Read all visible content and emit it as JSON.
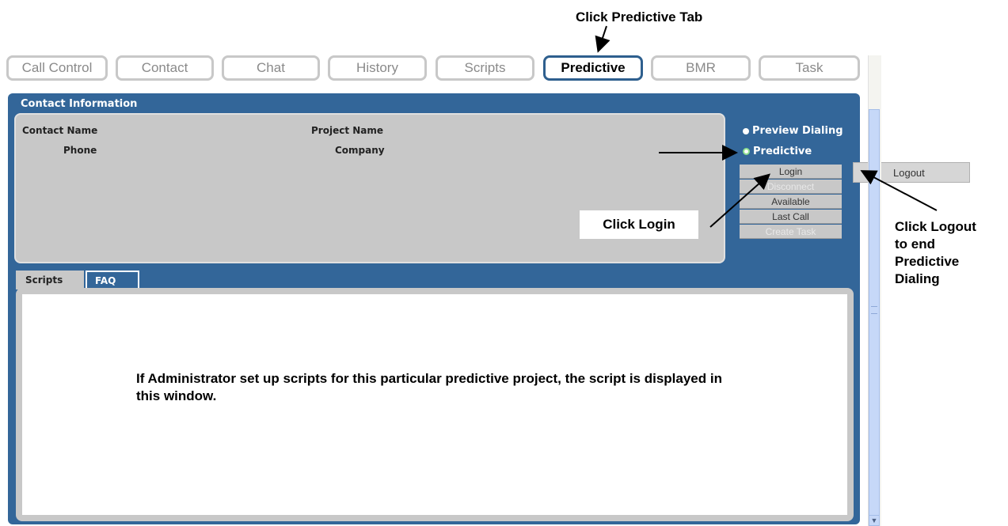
{
  "tabs": [
    {
      "label": "Call Control"
    },
    {
      "label": "Contact"
    },
    {
      "label": "Chat"
    },
    {
      "label": "History"
    },
    {
      "label": "Scripts"
    },
    {
      "label": "Predictive",
      "active": true
    },
    {
      "label": "BMR"
    },
    {
      "label": "Task"
    }
  ],
  "contact_panel": {
    "title": "Contact Information",
    "contact_name_label": "Contact Name",
    "phone_label": "Phone",
    "project_name_label": "Project Name",
    "company_label": "Company"
  },
  "dialing": {
    "preview_label": "Preview Dialing",
    "predictive_label": "Predictive",
    "selected": "Predictive"
  },
  "side_buttons": [
    {
      "label": "Login",
      "enabled": true
    },
    {
      "label": "Disconnect",
      "enabled": false
    },
    {
      "label": "Available",
      "enabled": true
    },
    {
      "label": "Last Call",
      "enabled": true
    },
    {
      "label": "Create Task",
      "enabled": false
    }
  ],
  "logout_menu": {
    "label": "Logout"
  },
  "sub_tabs": {
    "scripts": "Scripts",
    "faq": "FAQ"
  },
  "script_message": "If Administrator set up scripts for this particular predictive project, the script is displayed in this window.",
  "annotations": {
    "predictive_tab": "Click Predictive Tab",
    "login": "Click Login",
    "logout_lines": [
      "Click Logout",
      "to end",
      "Predictive",
      "Dialing"
    ]
  },
  "colors": {
    "panel": "#336699",
    "contact_box": "#c8c8c8",
    "active_tab_border": "#2e5f8e"
  }
}
